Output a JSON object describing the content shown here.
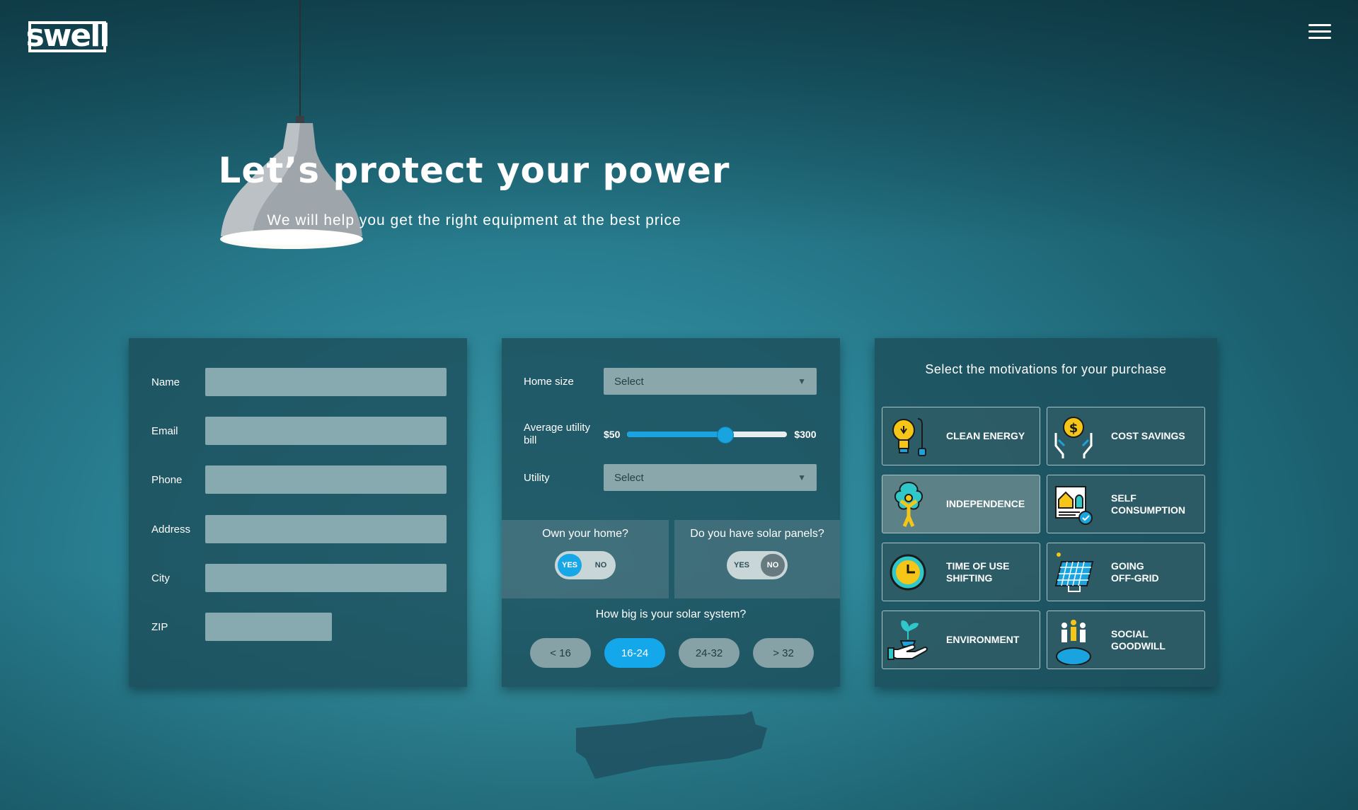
{
  "brand": {
    "logo_text": "swell"
  },
  "header": {
    "menu_icon": "hamburger-menu-icon"
  },
  "hero": {
    "title": "Let’s protect your power",
    "subtitle": "We will help you get the right equipment at the best price"
  },
  "contact_form": {
    "fields": [
      {
        "label": "Name",
        "value": ""
      },
      {
        "label": "Email",
        "value": ""
      },
      {
        "label": "Phone",
        "value": ""
      },
      {
        "label": "Address",
        "value": ""
      },
      {
        "label": "City",
        "value": ""
      },
      {
        "label": "ZIP",
        "value": ""
      }
    ]
  },
  "home_form": {
    "home_size": {
      "label": "Home size",
      "value": "Select"
    },
    "utility_bill": {
      "label": "Average utility bill",
      "min": "$50",
      "max": "$300",
      "fraction": 0.61
    },
    "utility": {
      "label": "Utility",
      "value": "Select"
    },
    "own_home": {
      "question": "Own your home?",
      "yes": "YES",
      "no": "NO",
      "selected": "YES"
    },
    "solar_panels": {
      "question": "Do you have solar panels?",
      "yes": "YES",
      "no": "NO",
      "selected": "NO"
    },
    "system_size": {
      "question": "How big is your solar system?",
      "options": [
        "< 16",
        "16-24",
        "24-32",
        "> 32"
      ],
      "selected": "16-24"
    }
  },
  "motivations": {
    "title": "Select the motivations for your purchase",
    "items": [
      {
        "label": "CLEAN ENERGY",
        "icon": "lightbulb-plug-icon",
        "selected": false
      },
      {
        "label": "COST SAVINGS",
        "icon": "hands-dollar-coin-icon",
        "selected": false
      },
      {
        "label": "INDEPENDENCE",
        "icon": "person-tree-icon",
        "selected": true
      },
      {
        "label": "SELF\nCONSUMPTION",
        "icon": "house-document-check-icon",
        "selected": false
      },
      {
        "label": "TIME OF USE\nSHIFTING",
        "icon": "clock-icon",
        "selected": false
      },
      {
        "label": "GOING\nOFF-GRID",
        "icon": "solar-panel-icon",
        "selected": false
      },
      {
        "label": "ENVIRONMENT",
        "icon": "hand-plant-icon",
        "selected": false
      },
      {
        "label": "SOCIAL\nGOODWILL",
        "icon": "people-globe-icon",
        "selected": false
      }
    ]
  },
  "colors": {
    "accent": "#14a7ea",
    "panel": "#1c4c58",
    "background": "#2a8193",
    "icon_yellow": "#f5c518"
  }
}
